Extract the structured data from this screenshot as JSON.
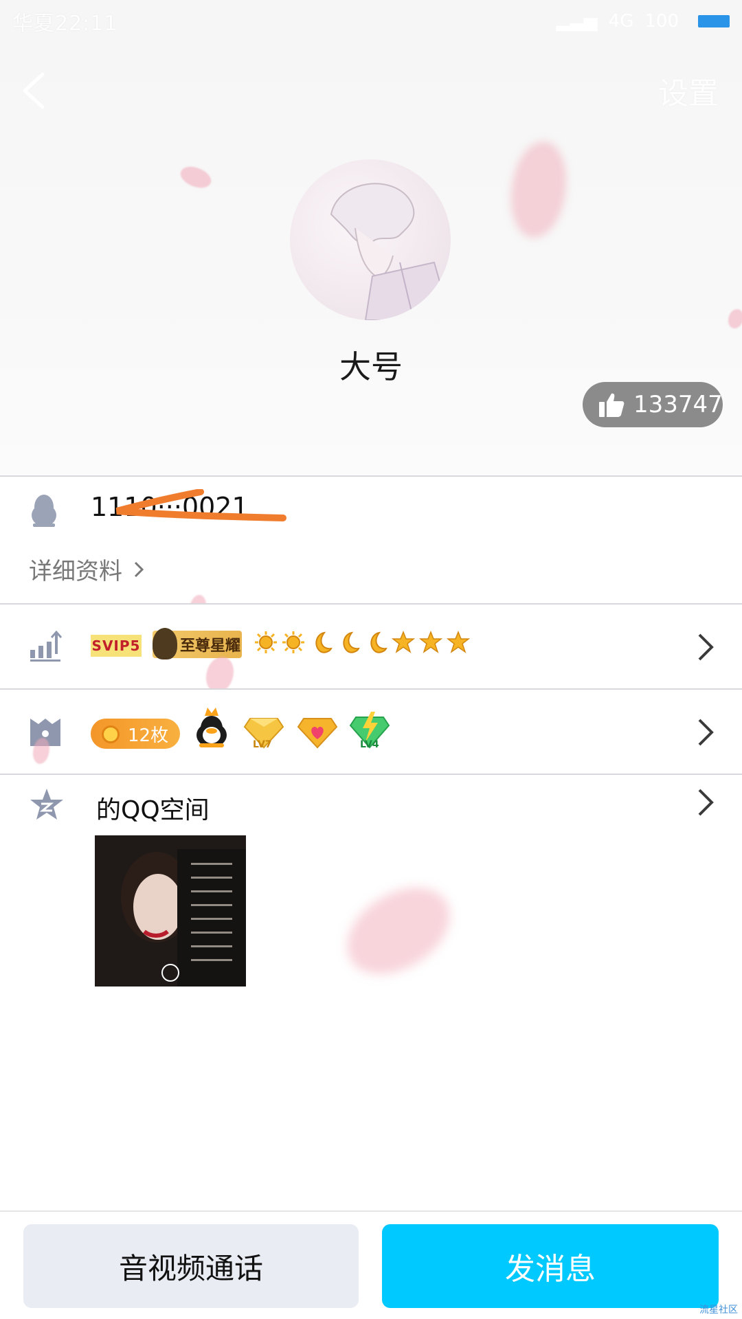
{
  "status_bar": {
    "carrier_time": "华夏22:11",
    "network": "4G",
    "battery": "100"
  },
  "nav": {
    "back_icon": "chevron-left-icon",
    "settings_label": "设置"
  },
  "profile": {
    "nickname": "大号",
    "likes": "133747",
    "qq_number": "1110···0021",
    "detail_label": "详细资料"
  },
  "vip_row": {
    "svip_label": "SVIP5",
    "supreme_label": "至尊星耀"
  },
  "badges_row": {
    "coin_label": "12枚",
    "lv_gold": "LV7",
    "lv_green": "LV4"
  },
  "qzone": {
    "title": "的QQ空间"
  },
  "actions": {
    "call_label": "音视频通话",
    "message_label": "发消息"
  },
  "watermark": "流星社区",
  "colors": {
    "accent": "#00c9ff",
    "call_bg": "#e9ecf3",
    "like_bg": "#8b8b8b",
    "coin": "#f4962a",
    "svip_bg": "#f7e27a"
  }
}
